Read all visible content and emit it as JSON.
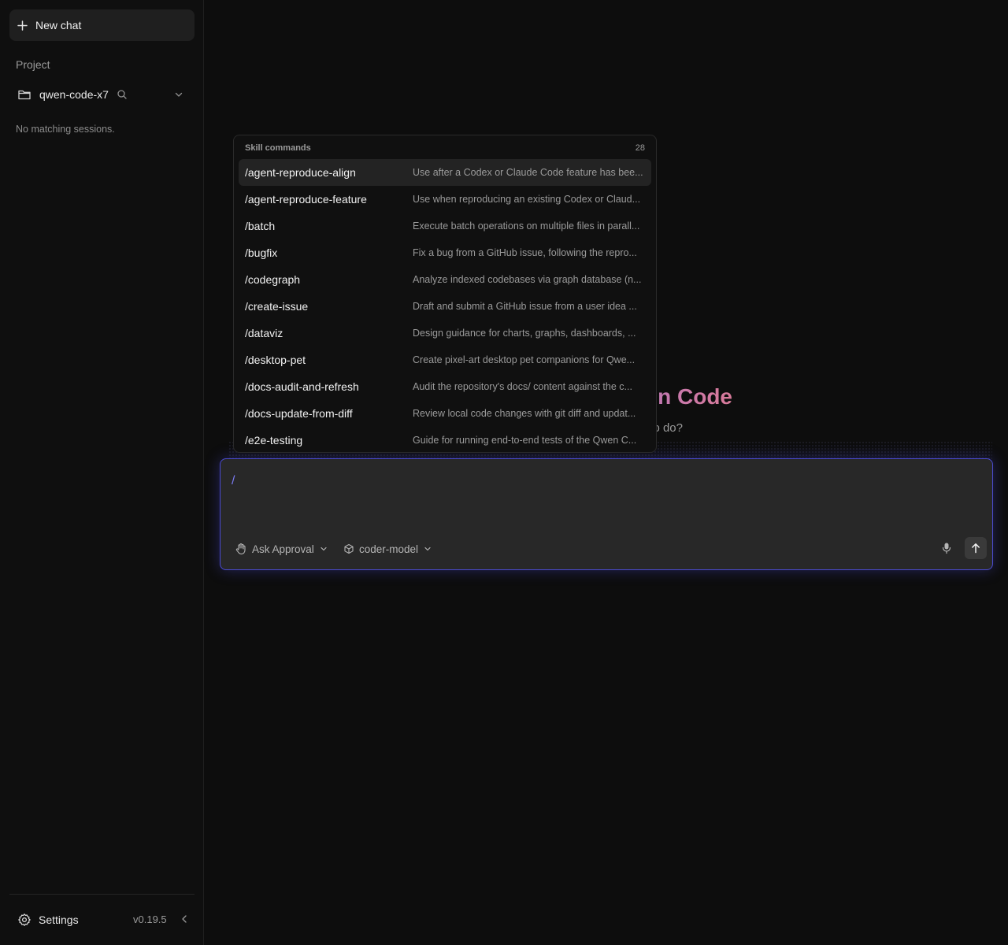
{
  "sidebar": {
    "new_chat_label": "New chat",
    "project_label": "Project",
    "project_name": "qwen-code-x7",
    "no_sessions_text": "No matching sessions.",
    "settings_label": "Settings",
    "version": "v0.19.5"
  },
  "hero": {
    "title_visible": "n Code",
    "subtitle_visible": "o do?"
  },
  "command_menu": {
    "header": "Skill commands",
    "count": "28",
    "items": [
      {
        "name": "/agent-reproduce-align",
        "desc": "Use after a Codex or Claude Code feature has bee..."
      },
      {
        "name": "/agent-reproduce-feature",
        "desc": "Use when reproducing an existing Codex or Claud..."
      },
      {
        "name": "/batch",
        "desc": "Execute batch operations on multiple files in parall..."
      },
      {
        "name": "/bugfix",
        "desc": "Fix a bug from a GitHub issue, following the repro..."
      },
      {
        "name": "/codegraph",
        "desc": "Analyze indexed codebases via graph database (n..."
      },
      {
        "name": "/create-issue",
        "desc": "Draft and submit a GitHub issue from a user idea ..."
      },
      {
        "name": "/dataviz",
        "desc": "Design guidance for charts, graphs, dashboards, ..."
      },
      {
        "name": "/desktop-pet",
        "desc": "Create pixel-art desktop pet companions for Qwe..."
      },
      {
        "name": "/docs-audit-and-refresh",
        "desc": "Audit the repository's docs/ content against the c..."
      },
      {
        "name": "/docs-update-from-diff",
        "desc": "Review local code changes with git diff and updat..."
      },
      {
        "name": "/e2e-testing",
        "desc": "Guide for running end-to-end tests of the Qwen C..."
      }
    ]
  },
  "composer": {
    "value": "/",
    "mode_label": "Ask Approval",
    "model_label": "coder-model"
  },
  "icons": {
    "new_chat": "plus-icon",
    "project": "folder-icon",
    "search": "search-icon",
    "project_toggle": "chevron-down-icon",
    "settings": "gear-icon",
    "collapse": "chevron-left-icon",
    "mode": "hand-icon",
    "model": "cube-icon",
    "mic": "microphone-icon",
    "send": "arrow-up-icon"
  },
  "colors": {
    "accent": "#4a4ad0",
    "background": "#0d0d0d",
    "title_gradient_start": "#8a74e8",
    "title_gradient_end": "#d97a9a"
  }
}
